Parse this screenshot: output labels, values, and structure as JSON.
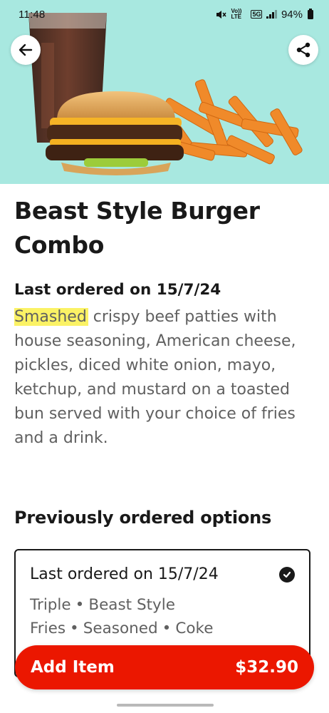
{
  "status_bar": {
    "time": "11:48",
    "volte": "Vo)) LTE",
    "network": "5G",
    "battery": "94%"
  },
  "header": {
    "back_icon": "arrow-left-icon",
    "share_icon": "share-icon",
    "hero_image": "burger-fries-drink-photo"
  },
  "product": {
    "title": "Beast Style Burger Combo",
    "last_ordered": "Last ordered on 15/7/24",
    "description_highlight": "Smashed",
    "description_rest": " crispy beef patties with house seasoning, American cheese, pickles, diced white onion, mayo, ketchup, and mustard on a toasted bun served with your choice of fries and a drink."
  },
  "previous_options": {
    "title": "Previously ordered options",
    "card": {
      "date": "Last ordered on 15/7/24",
      "items": [
        "Triple",
        "Beast Style Fries",
        "Seasoned",
        "Coke"
      ],
      "separator": "•",
      "selected": true
    }
  },
  "footer": {
    "add_label": "Add Item",
    "price": "$32.90"
  },
  "colors": {
    "accent": "#eb1700",
    "hero_bg": "#a8e8e0",
    "highlight": "#fbf265",
    "text_primary": "#191919",
    "text_secondary": "#606060"
  }
}
